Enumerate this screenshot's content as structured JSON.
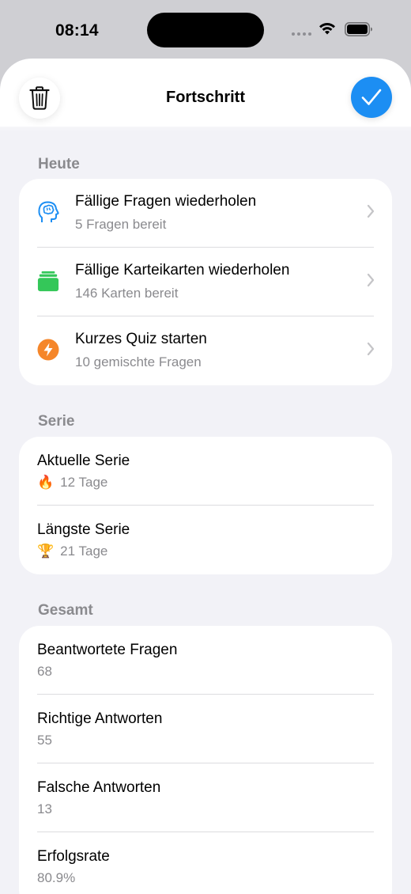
{
  "status_bar": {
    "time": "08:14"
  },
  "nav": {
    "title": "Fortschritt"
  },
  "today": {
    "header": "Heute",
    "items": [
      {
        "title": "Fällige Fragen wiederholen",
        "subtitle": "5 Fragen bereit",
        "icon": "brain-icon",
        "color": "#1c8ef3"
      },
      {
        "title": "Fällige Karteikarten wiederholen",
        "subtitle": "146 Karten bereit",
        "icon": "cards-icon",
        "color": "#34c759"
      },
      {
        "title": "Kurzes Quiz starten",
        "subtitle": "10 gemischte Fragen",
        "icon": "bolt-icon",
        "color": "#f5862a"
      }
    ]
  },
  "streak": {
    "header": "Serie",
    "items": [
      {
        "title": "Aktuelle Serie",
        "emoji": "🔥",
        "value": "12 Tage"
      },
      {
        "title": "Längste Serie",
        "emoji": "🏆",
        "value": "21 Tage"
      }
    ]
  },
  "total": {
    "header": "Gesamt",
    "items": [
      {
        "title": "Beantwortete Fragen",
        "value": "68"
      },
      {
        "title": "Richtige Antworten",
        "value": "55"
      },
      {
        "title": "Falsche Antworten",
        "value": "13"
      },
      {
        "title": "Erfolgsrate",
        "value": "80.9%"
      }
    ]
  }
}
